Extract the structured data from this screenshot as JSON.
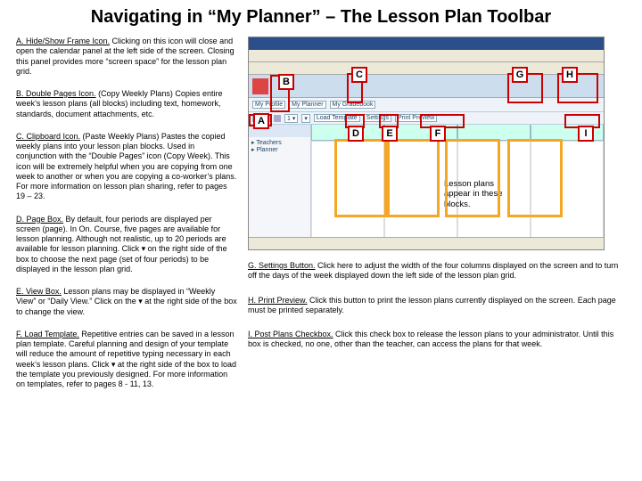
{
  "title": "Navigating in “My Planner” – The Lesson Plan Toolbar",
  "items": {
    "A": {
      "label": "A.  Hide/Show Frame Icon.",
      "body": " Clicking on this icon will close and open the calendar panel at the left side of the screen.    Closing this panel provides more “screen space” for the lesson plan grid."
    },
    "B": {
      "label": "B.  Double Pages Icon.",
      "body": " (Copy Weekly Plans) Copies entire week’s lesson plans (all blocks) including text, homework, standards, document attachments, etc."
    },
    "C": {
      "label": "C.  Clipboard Icon.",
      "body": "  (Paste Weekly Plans)  Pastes the copied weekly plans into your lesson plan blocks. Used in conjunction with the “Double Pages” icon (Copy Week). This icon will be extremely helpful when you are copying from one week to another or when you are copying a co-worker’s plans.  For more information on lesson plan sharing, refer to pages  19 – 23."
    },
    "D": {
      "label": "D.  Page Box.",
      "body": "  By default, four periods are displayed per screen (page). In On. Course, five pages are available for lesson planning. Although not realistic, up to 20 periods are available for lesson planning.  Click  ▾  on the right side of the box to choose the next page (set of four periods) to be displayed in the lesson plan grid."
    },
    "E": {
      "label": "E.  View Box.",
      "body": "  Lesson plans may be displayed in “Weekly View” or “Daily View.” Click on the ▾  at the right side of the box to change the view."
    },
    "F": {
      "label": "F.  Load Template.",
      "body": "    Repetitive entries can be saved in a lesson plan template. Careful planning and design of your template will reduce the amount of repetitive typing necessary in each week’s lesson plans.  Click ▾  at the right side of the box to load the template you previously designed. For more information on templates, refer to pages 8 - 11, 13."
    },
    "G": {
      "label": "G.  Settings Button.",
      "body": "  Click here to adjust the width of the four columns displayed on the screen and to turn off the days of the week displayed down the left side of the lesson plan grid."
    },
    "H": {
      "label": "H.  Print Preview.",
      "body": "  Click this button to print the lesson plans currently displayed on the screen.  Each page must be printed separately."
    },
    "I": {
      "label": "I.  Post Plans Checkbox.",
      "body": "   Click this check box to release the lesson plans to your administrator.  Until this box is checked, no one, other than the teacher, can access the plans for that week."
    }
  },
  "letters": {
    "A": "A",
    "B": "B",
    "C": "C",
    "D": "D",
    "E": "E",
    "F": "F",
    "G": "G",
    "H": "H",
    "I": "I"
  },
  "note": "Lesson plans appear in these blocks.",
  "shot": {
    "subbarItems": [
      "My Profile",
      "My Planner",
      "My Gradebook"
    ],
    "toolbarItems": [
      "Load Template",
      "Settings",
      "Print Preview"
    ]
  }
}
